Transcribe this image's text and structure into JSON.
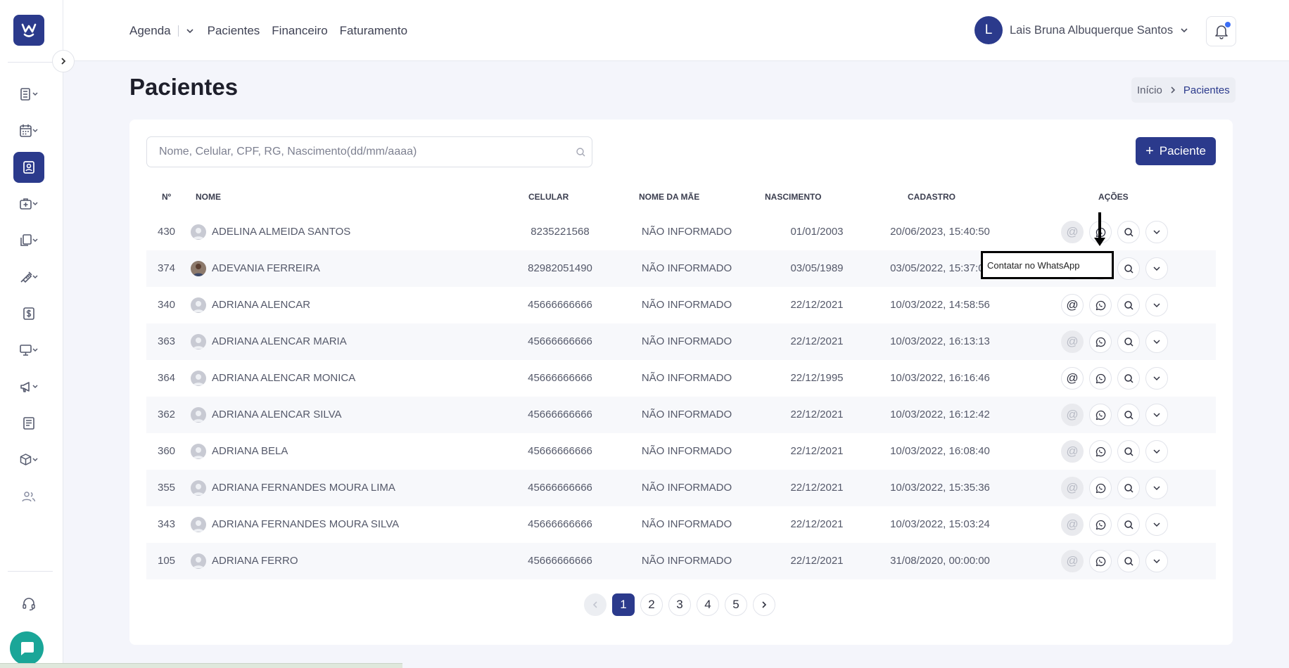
{
  "colors": {
    "primary": "#2b3a8c",
    "chat": "#1aa698",
    "notification_dot": "#3b6ef5"
  },
  "logo": {
    "glyph": "w",
    "icon": "brand-logo"
  },
  "sidebar": {
    "items": [
      {
        "name": "sidebar-item-prontuario",
        "icon": "notebook-icon",
        "dropdown": true
      },
      {
        "name": "sidebar-item-agenda",
        "icon": "calendar-icon",
        "dropdown": true
      },
      {
        "name": "sidebar-item-pacientes",
        "icon": "contact-card-icon",
        "active": true
      },
      {
        "name": "sidebar-item-clinica",
        "icon": "medical-case-icon",
        "dropdown": true
      },
      {
        "name": "sidebar-item-documentos",
        "icon": "documents-icon",
        "dropdown": true
      },
      {
        "name": "sidebar-item-procedimentos",
        "icon": "syringe-icon",
        "dropdown": true
      },
      {
        "name": "sidebar-item-financeiro",
        "icon": "dollar-icon"
      },
      {
        "name": "sidebar-item-telemedicina",
        "icon": "monitor-icon",
        "dropdown": true
      },
      {
        "name": "sidebar-item-marketing",
        "icon": "megaphone-icon",
        "dropdown": true
      },
      {
        "name": "sidebar-item-relatorios",
        "icon": "report-icon"
      },
      {
        "name": "sidebar-item-estoque",
        "icon": "box-icon",
        "dropdown": true
      },
      {
        "name": "sidebar-item-usuarios",
        "icon": "users-icon"
      }
    ],
    "support_icon": "headset-icon",
    "chat_icon": "chat-bubble-icon"
  },
  "topnav": {
    "agenda": "Agenda",
    "pacientes": "Pacientes",
    "financeiro": "Financeiro",
    "faturamento": "Faturamento"
  },
  "user": {
    "initial": "L",
    "name": "Lais Bruna Albuquerque Santos"
  },
  "page": {
    "title": "Pacientes"
  },
  "breadcrumb": {
    "home": "Início",
    "current": "Pacientes"
  },
  "search": {
    "placeholder": "Nome, Celular, CPF, RG, Nascimento(dd/mm/aaaa)",
    "value": ""
  },
  "add_button": {
    "label": "Paciente"
  },
  "table": {
    "headers": {
      "num": "Nº",
      "nome": "NOME",
      "celular": "CELULAR",
      "mae": "NOME DA MÃE",
      "nascimento": "NASCIMENTO",
      "cadastro": "CADASTRO",
      "acoes": "AÇÕES"
    },
    "rows": [
      {
        "num": "430",
        "nome": "ADELINA ALMEIDA SANTOS",
        "celular": "8235221568",
        "mae": "NÃO INFORMADO",
        "nascimento": "01/01/2003",
        "cadastro": "20/06/2023, 15:40:50",
        "email_enabled": false,
        "photo": false
      },
      {
        "num": "374",
        "nome": "ADEVANIA FERREIRA",
        "celular": "82982051490",
        "mae": "NÃO INFORMADO",
        "nascimento": "03/05/1989",
        "cadastro": "03/05/2022, 15:37:08",
        "email_enabled": true,
        "photo": true
      },
      {
        "num": "340",
        "nome": "ADRIANA ALENCAR",
        "celular": "45666666666",
        "mae": "NÃO INFORMADO",
        "nascimento": "22/12/2021",
        "cadastro": "10/03/2022, 14:58:56",
        "email_enabled": true,
        "photo": false
      },
      {
        "num": "363",
        "nome": "ADRIANA ALENCAR MARIA",
        "celular": "45666666666",
        "mae": "NÃO INFORMADO",
        "nascimento": "22/12/2021",
        "cadastro": "10/03/2022, 16:13:13",
        "email_enabled": false,
        "photo": false
      },
      {
        "num": "364",
        "nome": "ADRIANA ALENCAR MONICA",
        "celular": "45666666666",
        "mae": "NÃO INFORMADO",
        "nascimento": "22/12/1995",
        "cadastro": "10/03/2022, 16:16:46",
        "email_enabled": true,
        "photo": false
      },
      {
        "num": "362",
        "nome": "ADRIANA ALENCAR SILVA",
        "celular": "45666666666",
        "mae": "NÃO INFORMADO",
        "nascimento": "22/12/2021",
        "cadastro": "10/03/2022, 16:12:42",
        "email_enabled": false,
        "photo": false
      },
      {
        "num": "360",
        "nome": "ADRIANA BELA",
        "celular": "45666666666",
        "mae": "NÃO INFORMADO",
        "nascimento": "22/12/2021",
        "cadastro": "10/03/2022, 16:08:40",
        "email_enabled": false,
        "photo": false
      },
      {
        "num": "355",
        "nome": "ADRIANA FERNANDES MOURA LIMA",
        "celular": "45666666666",
        "mae": "NÃO INFORMADO",
        "nascimento": "22/12/2021",
        "cadastro": "10/03/2022, 15:35:36",
        "email_enabled": false,
        "photo": false
      },
      {
        "num": "343",
        "nome": "ADRIANA FERNANDES MOURA SILVA",
        "celular": "45666666666",
        "mae": "NÃO INFORMADO",
        "nascimento": "22/12/2021",
        "cadastro": "10/03/2022, 15:03:24",
        "email_enabled": false,
        "photo": false
      },
      {
        "num": "105",
        "nome": "ADRIANA FERRO",
        "celular": "45666666666",
        "mae": "NÃO INFORMADO",
        "nascimento": "22/12/2021",
        "cadastro": "31/08/2020, 00:00:00",
        "email_enabled": false,
        "photo": false
      }
    ]
  },
  "tooltip": {
    "text": "Contatar no WhatsApp"
  },
  "pagination": {
    "pages": [
      "1",
      "2",
      "3",
      "4",
      "5"
    ],
    "current": "1"
  }
}
